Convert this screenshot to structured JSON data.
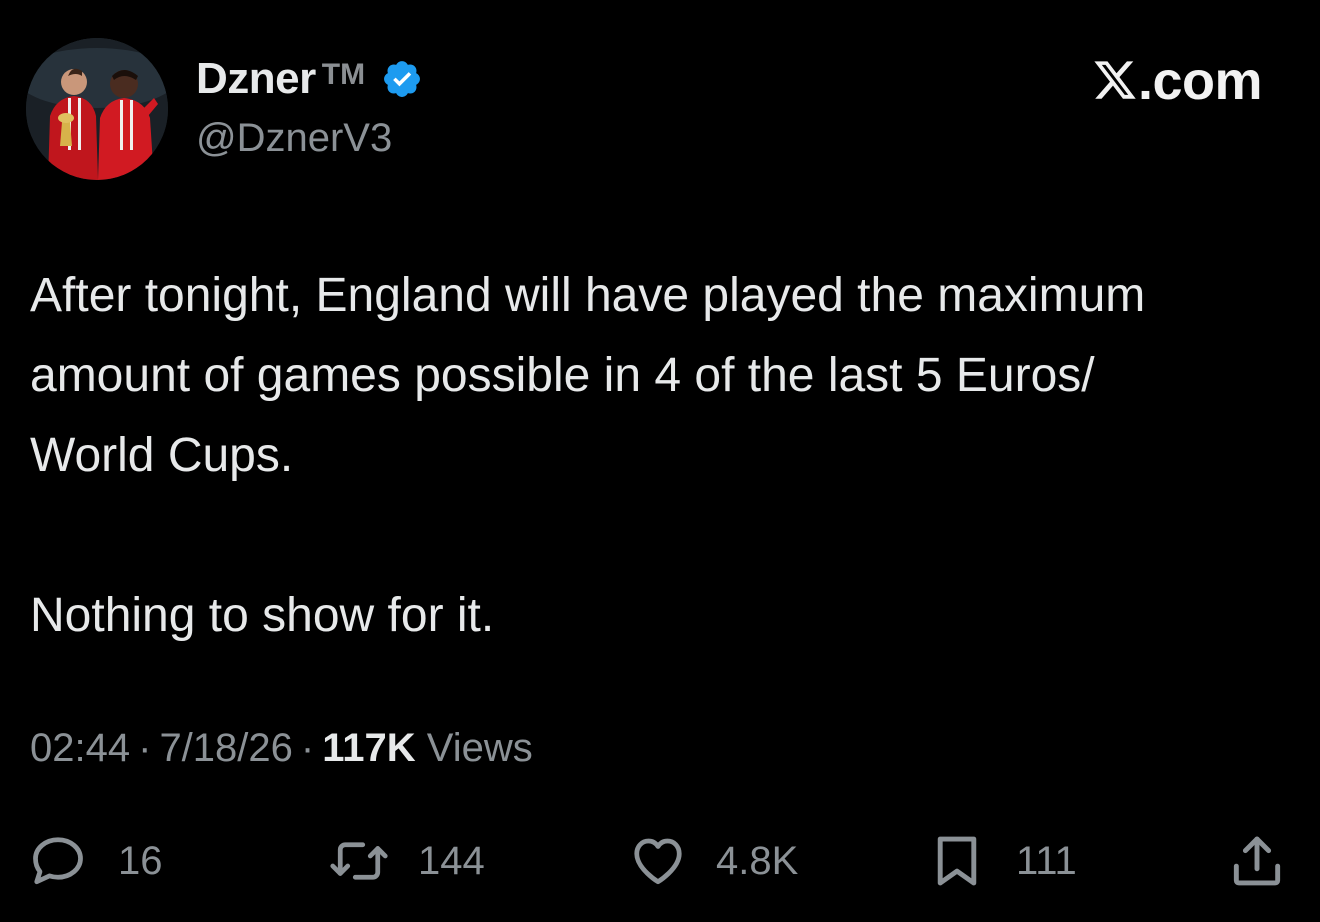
{
  "author": {
    "display_name": "Dzner",
    "tm_mark": "TM",
    "handle": "@DznerV3",
    "verified": true,
    "verified_color": "#1d9bf0"
  },
  "brand": {
    "label": ".com",
    "icon": "x-logo-icon"
  },
  "tweet": {
    "paragraphs": [
      "After tonight, England will have played the maximum",
      "amount of games possible in 4 of the last 5 Euros/",
      "World Cups.",
      "Nothing to show for it."
    ]
  },
  "meta": {
    "time": "02:44",
    "separator": "·",
    "date": "7/18/26",
    "views_count": "117K",
    "views_label": "Views"
  },
  "actions": {
    "replies": "16",
    "reposts": "144",
    "likes": "4.8K",
    "bookmarks": "111",
    "icons": [
      "reply-icon",
      "repost-icon",
      "like-icon",
      "bookmark-icon",
      "share-icon"
    ]
  },
  "colors": {
    "background": "#000000",
    "text": "#e7e9ea",
    "muted": "#8b9196"
  }
}
